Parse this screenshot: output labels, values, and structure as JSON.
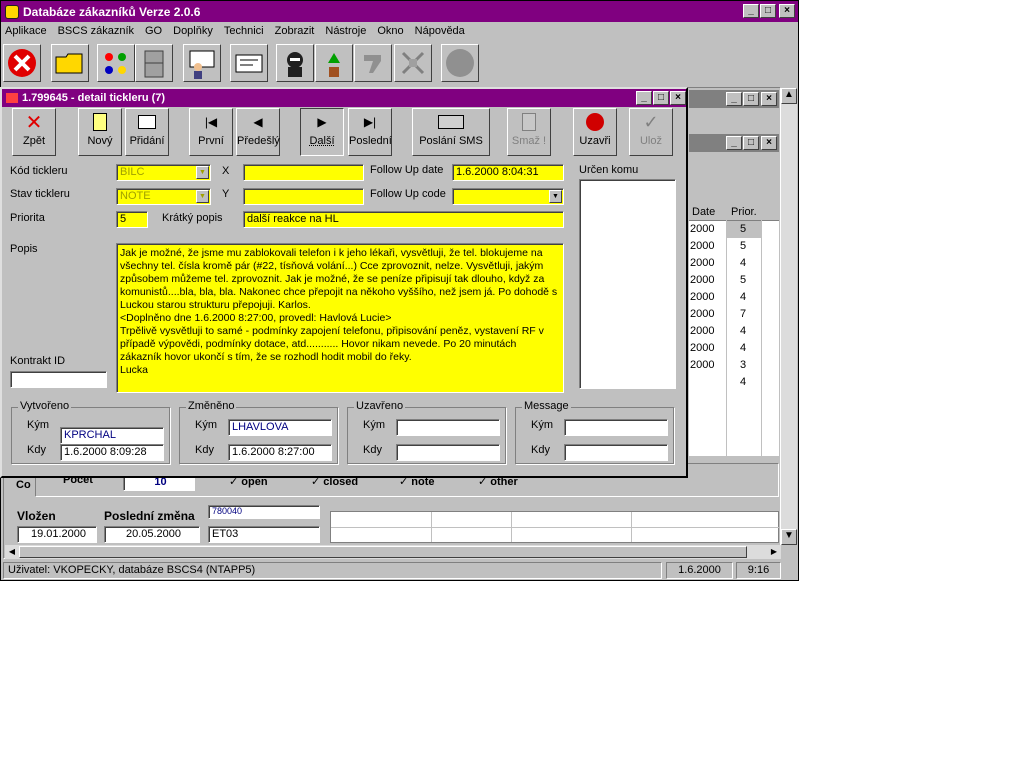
{
  "app": {
    "title": "Databáze zákazníků   Verze 2.0.6",
    "menu": [
      "Aplikace",
      "BSCS zákazník",
      "GO",
      "Doplňky",
      "Technici",
      "Zobrazit",
      "Nástroje",
      "Okno",
      "Nápověda"
    ]
  },
  "toolbar_icons": [
    "close-red-icon",
    "folder-icon",
    "people-icon",
    "cabinet-icon",
    "presenter-icon",
    "card-icon",
    "spy-icon",
    "plant-icon",
    "tool-icon",
    "satellite-icon",
    "circle-icon"
  ],
  "dialog": {
    "title": "1.799645 - detail tickleru (7)",
    "buttons": [
      "Zpět",
      "Nový",
      "Přidání",
      "První",
      "Předešlý",
      "Další",
      "Poslední",
      "Poslání SMS",
      "Smaž !",
      "Uzavři",
      "Ulož"
    ],
    "fields": {
      "kod_label": "Kód tickleru",
      "kod_value": "BILC",
      "stav_label": "Stav tickleru",
      "stav_value": "NOTE",
      "priorita_label": "Priorita",
      "priorita_value": "5",
      "x_label": "X",
      "y_label": "Y",
      "followup_date_label": "Follow Up date",
      "followup_date_value": "1.6.2000 8:04:31",
      "followup_code_label": "Follow Up code",
      "kratky_popis_label": "Krátký popis",
      "kratky_popis_value": "další reakce na HL",
      "urcen_komu_label": "Určen komu",
      "popis_label": "Popis",
      "popis_value": "Jak je možné, že jsme mu zablokovali telefon i k jeho lékaři, vysvětluji, že tel. blokujeme na všechny tel. čísla kromě pár (#22, tísňová volání...) Cce zprovoznit, nelze. Vysvětluji, jakým způsobem můžeme tel. zprovoznit. Jak je možné, že se peníze připisují tak dlouho, když za komunistů....bla, bla, bla. Nakonec chce přepojit na někoho vyššího, než jsem já. Po dohodě s Luckou starou strukturu přepojuji. Karlos.\n<Doplněno dne 1.6.2000 8:27:00, provedl: Havlová Lucie>\nTrpělivě vysvětluji to samé - podmínky zapojení telefonu, připisování peněz, vystavení RF v případě výpovědi, podmínky dotace, atd........... Hovor nikam nevede. Po 20 minutách zákazník hovor ukončí s tím, že se rozhodl hodit mobil do řeky.\nLucka",
      "kontrakt_label": "Kontrakt ID"
    },
    "groups": {
      "vytvoreno": {
        "title": "Vytvořeno",
        "kym_label": "Kým",
        "kym": "KPRCHAL",
        "kdy_label": "Kdy",
        "kdy": "1.6.2000 8:09:28"
      },
      "zmeneno": {
        "title": "Změněno",
        "kym_label": "Kým",
        "kym": "LHAVLOVA",
        "kdy_label": "Kdy",
        "kdy": "1.6.2000 8:27:00"
      },
      "uzavreno": {
        "title": "Uzavřeno",
        "kym_label": "Kým",
        "kym": "",
        "kdy_label": "Kdy",
        "kdy": ""
      },
      "message": {
        "title": "Message",
        "kym_label": "Kým",
        "kym": "",
        "kdy_label": "Kdy",
        "kdy": ""
      }
    }
  },
  "background": {
    "grid_headers": [
      "Date",
      "Prior."
    ],
    "grid_rows": [
      [
        "2000",
        "5"
      ],
      [
        "2000",
        "5"
      ],
      [
        "2000",
        "4"
      ],
      [
        "2000",
        "5"
      ],
      [
        "2000",
        "4"
      ],
      [
        "2000",
        "7"
      ],
      [
        "2000",
        "4"
      ],
      [
        "2000",
        "4"
      ],
      [
        "2000",
        "3"
      ],
      [
        "",
        "4"
      ]
    ],
    "filters": {
      "pocet_label": "Počet",
      "pocet_value": "10",
      "co_label": "Co",
      "open": "open",
      "closed": "closed",
      "note": "note",
      "other": "other"
    },
    "vlozen_label": "Vložen",
    "vlozen_value": "19.01.2000",
    "posledni_zmena_label": "Poslední změna",
    "posledni_zmena_value": "20.05.2000",
    "code1": "780040",
    "code2": "ET03"
  },
  "statusbar": {
    "user": "Uživatel: VKOPECKY, databáze BSCS4 (NTAPP5)",
    "date": "1.6.2000",
    "time": "9:16"
  },
  "colors": {
    "title": "#800080",
    "field_yellow": "#ffff00",
    "face": "#c0c0c0"
  }
}
